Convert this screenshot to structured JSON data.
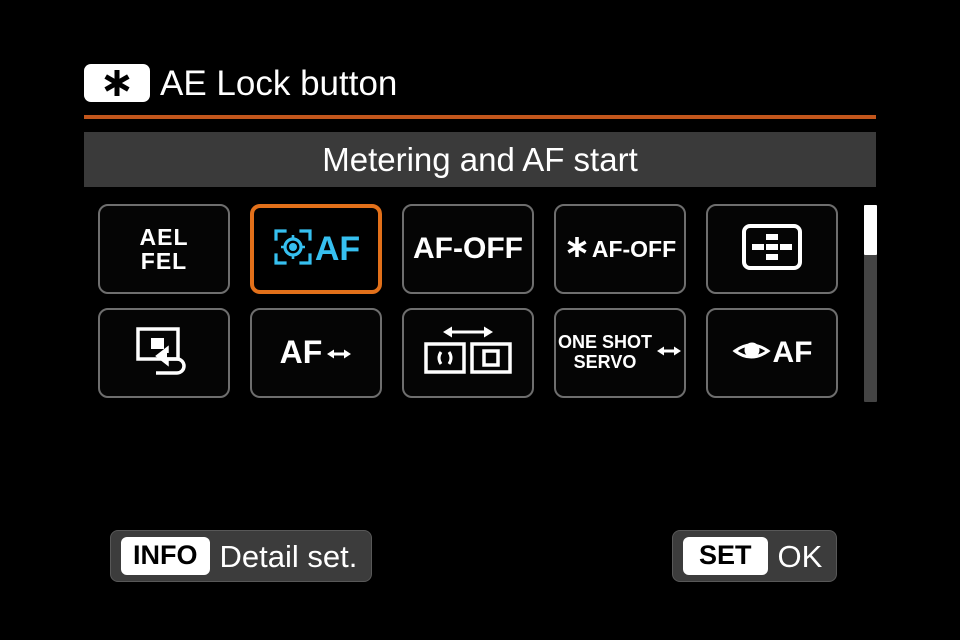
{
  "screen": {
    "background_color": "#000000",
    "accent_color": "#e2701a",
    "divider_color": "#c2561c",
    "subtitle_bar_color": "#3a3a3a",
    "cyan_color": "#36c0f0"
  },
  "header": {
    "badge_icon": "ae-lock-star-icon",
    "title": "AE Lock button"
  },
  "subtitle": {
    "text": "Metering and AF start"
  },
  "options": [
    {
      "id": "ael-fel",
      "kind": "text-two-line",
      "line1": "AEL",
      "line2": "FEL",
      "selected": false
    },
    {
      "id": "metering-and-af-start",
      "kind": "icon-text",
      "icon": "metering-frame-icon",
      "text": "AF",
      "selected": true
    },
    {
      "id": "af-off",
      "kind": "text",
      "text": "AF-OFF",
      "selected": false
    },
    {
      "id": "ae-lock-af-off",
      "kind": "star-text",
      "icon": "star-icon",
      "text": "AF-OFF",
      "selected": false
    },
    {
      "id": "af-point-selection",
      "kind": "icon",
      "icon": "af-point-selection-icon",
      "selected": false
    },
    {
      "id": "registered-af-point",
      "kind": "icon",
      "icon": "registered-af-point-icon",
      "selected": false
    },
    {
      "id": "af-method-switch",
      "kind": "text-arrow",
      "text": "AF",
      "icon": "left-right-arrow-icon",
      "selected": false
    },
    {
      "id": "af-area-switch",
      "kind": "icon",
      "icon": "af-area-switch-icon",
      "selected": false
    },
    {
      "id": "one-shot-servo",
      "kind": "text-two-line-arrow",
      "line1": "ONE SHOT",
      "line2": "SERVO",
      "icon": "left-right-arrow-icon",
      "selected": false
    },
    {
      "id": "eye-detection-af",
      "kind": "icon-text",
      "icon": "eye-af-icon",
      "text": "AF",
      "selected": false
    }
  ],
  "scrollbar": {
    "position": "top",
    "thumb_fraction": "0.25"
  },
  "footer": {
    "info_key": "INFO",
    "info_label": "Detail set.",
    "set_key": "SET",
    "set_label": "OK"
  }
}
